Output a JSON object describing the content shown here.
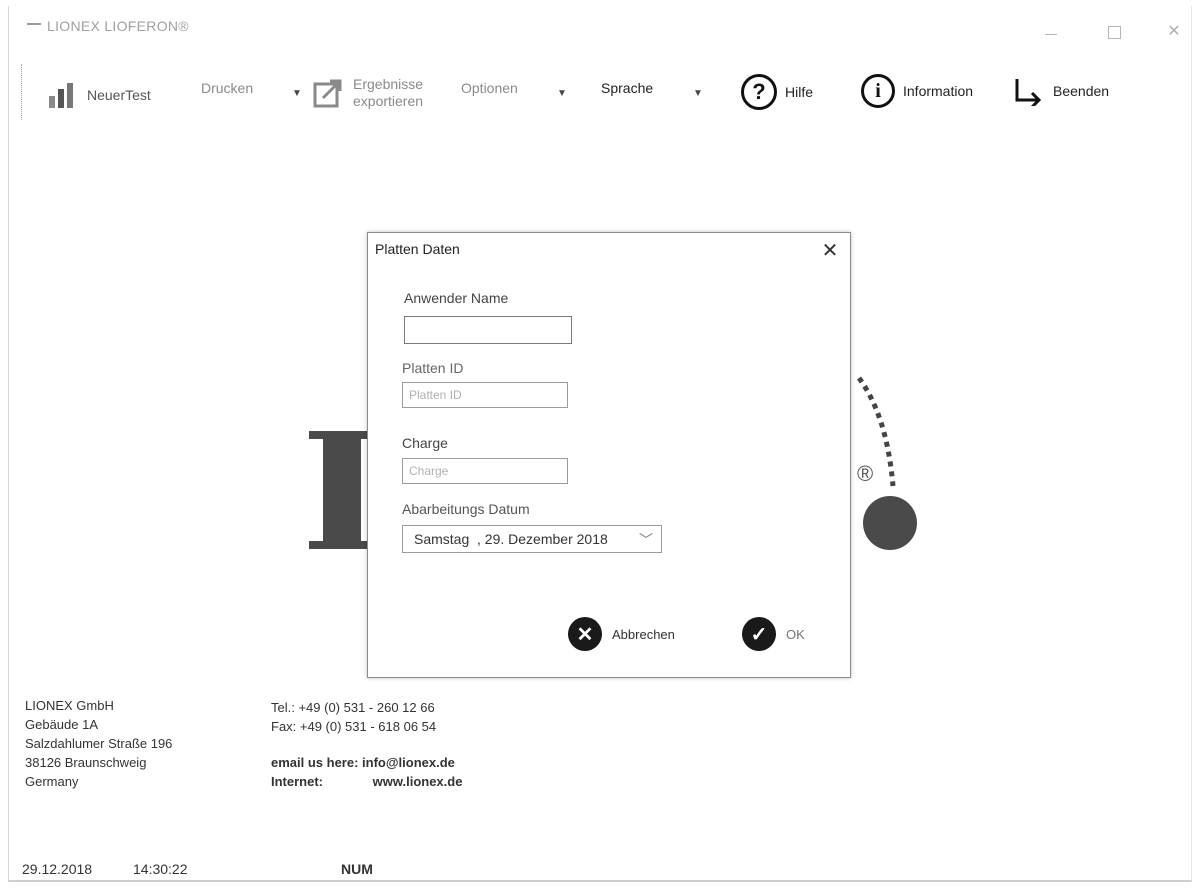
{
  "window": {
    "title": "LIONEX LIOFERON®"
  },
  "toolbar": {
    "new_test": "NeuerTest",
    "print": "Drucken",
    "export_line1": "Ergebnisse",
    "export_line2": "exportieren",
    "options": "Optionen",
    "language": "Sprache",
    "help": "Hilfe",
    "information": "Information",
    "exit": "Beenden"
  },
  "dialog": {
    "title": "Platten Daten",
    "user_name_label": "Anwender Name",
    "user_name_value": "",
    "plate_id_label": "Platten ID",
    "plate_id_placeholder": "Platten ID",
    "batch_label": "Charge",
    "batch_placeholder": "Charge",
    "date_label": "Abarbeitungs Datum",
    "date_value": "Samstag  , 29. Dezember 2018",
    "cancel_label": "Abbrechen",
    "ok_label": "OK"
  },
  "footer": {
    "address": [
      "LIONEX GmbH",
      "Gebäude 1A",
      "Salzdahlumer Straße 196",
      "38126 Braunschweig",
      "Germany"
    ],
    "tel": "Tel.: +49 (0) 531 - 260 12 66",
    "fax": "Fax: +49 (0) 531 - 618 06 54",
    "email": "email us here: info@lionex.de",
    "internet_label": "Internet:",
    "internet_value": "www.lionex.de"
  },
  "status": {
    "date": "29.12.2018",
    "time": "14:30:22",
    "num": "NUM"
  },
  "icons": {
    "new_test": "bar-chart-icon",
    "export": "export-icon",
    "help": "question-circle-icon",
    "info": "info-circle-icon",
    "exit": "exit-arrow-icon"
  }
}
